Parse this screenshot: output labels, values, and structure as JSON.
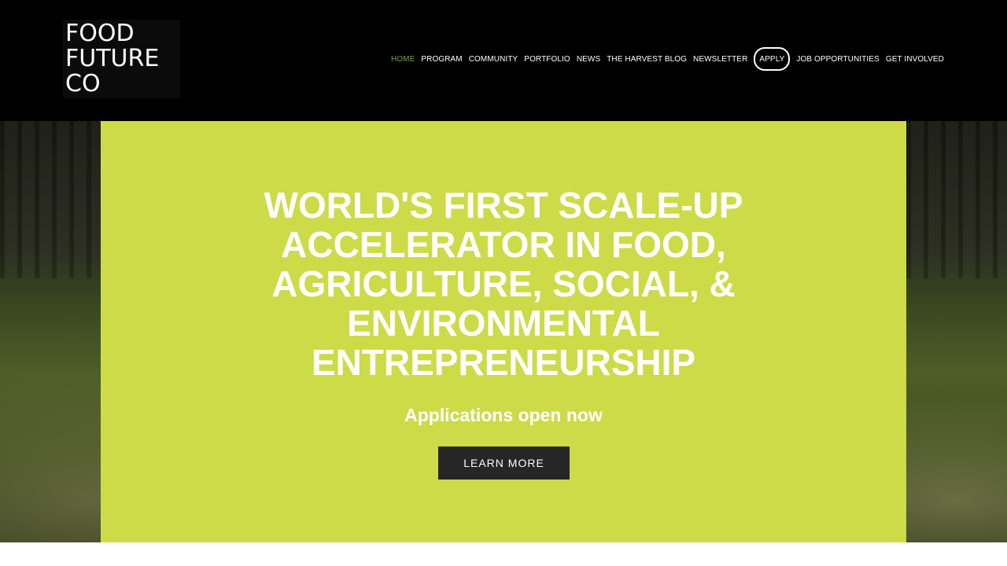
{
  "header": {
    "logo_lines": [
      "FOOD",
      "FUTURE",
      "CO"
    ]
  },
  "nav": {
    "items": [
      {
        "label": "HOME",
        "active": true
      },
      {
        "label": "PROGRAM"
      },
      {
        "label": "COMMUNITY"
      },
      {
        "label": "PORTFOLIO"
      },
      {
        "label": "NEWS"
      },
      {
        "label": "THE HARVEST BLOG"
      },
      {
        "label": "NEWSLETTER"
      },
      {
        "label": "APPLY",
        "outlined": true
      },
      {
        "label": "JOB OPPORTUNITIES"
      },
      {
        "label": "GET INVOLVED"
      }
    ]
  },
  "hero": {
    "title": "WORLD'S FIRST SCALE-UP ACCELERATOR IN FOOD, AGRICULTURE, SOCIAL, & ENVIRONMENTAL ENTREPRENEURSHIP",
    "subtitle": "Applications open now",
    "cta_label": "LEARN MORE"
  },
  "colors": {
    "header_bg": "#000000",
    "panel_bg": "#cddb49",
    "active_nav": "#6fa24a",
    "button_bg": "#262626"
  }
}
